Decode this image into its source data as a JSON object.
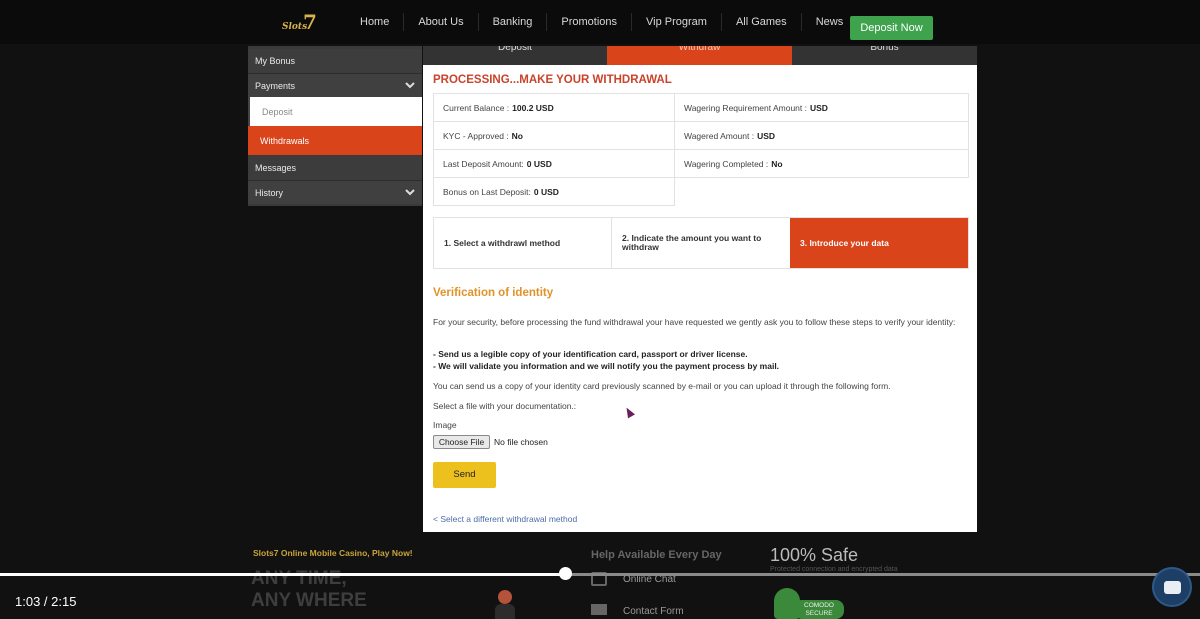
{
  "header": {
    "logo_text": "Slots",
    "logo_seven": "7",
    "nav": [
      "Home",
      "About Us",
      "Banking",
      "Promotions",
      "Vip Program",
      "All Games",
      "News"
    ],
    "deposit_now": "Deposit Now",
    "deposit_now_color": "#3fa34d"
  },
  "sidebar": {
    "items": [
      {
        "label": "My Bonus"
      },
      {
        "label": "Payments",
        "icon": "chevron-down-icon"
      },
      {
        "label": "Deposit"
      },
      {
        "label": "Withdrawals"
      },
      {
        "label": "Messages"
      },
      {
        "label": "History",
        "icon": "chevron-down-icon"
      }
    ],
    "active_color": "#d9441b"
  },
  "tabs": [
    "Deposit",
    "Withdraw",
    "Bonus"
  ],
  "main": {
    "title": "PROCESSING...MAKE YOUR WITHDRAWAL",
    "info": {
      "current_balance_label": "Current Balance :",
      "current_balance_value": "100.2 USD",
      "wagering_req_label": "Wagering Requirement Amount :",
      "wagering_req_value": "USD",
      "kyc_label": "KYC - Approved :",
      "kyc_value": "No",
      "wagered_label": "Wagered Amount :",
      "wagered_value": "USD",
      "last_deposit_label": "Last Deposit Amount:",
      "last_deposit_value": "0 USD",
      "wagering_completed_label": "Wagering Completed :",
      "wagering_completed_value": "No",
      "bonus_last_label": "Bonus on Last Deposit:",
      "bonus_last_value": "0 USD"
    },
    "steps": [
      "1. Select a withdrawl method",
      "2. Indicate the amount you want to withdraw",
      "3. Introduce your data"
    ],
    "verification_title": "Verification of identity",
    "intro": "For your security, before processing the fund withdrawal your have requested we gently ask you to follow these steps to verify your identity:",
    "bullet1": "- Send us a legible copy of your identification card, passport or driver license.",
    "bullet2": "- We will validate you information and we will notify you the payment process by mail.",
    "send_copy": "You can send us a copy of your identity card previously scanned by e-mail or you can upload it through the following form.",
    "select_file": "Select a file with your documentation.:",
    "image_label": "Image",
    "choose_file": "Choose File",
    "no_file": "No file chosen",
    "send": "Send",
    "select_different": "< Select a different withdrawal method"
  },
  "footer": {
    "promo": "Slots7 Online Mobile Casino, Play Now!",
    "anytime_line1": "ANY TIME,",
    "anytime_line2": "ANY WHERE",
    "help_title": "Help Available Every Day",
    "online_chat": "Online Chat",
    "contact_form": "Contact Form",
    "safe_title": "100% Safe",
    "safe_sub": "Protected connection and encrypted data",
    "comodo_line1": "COMODO",
    "comodo_line2": "SECURE"
  },
  "video": {
    "time": "1:03 / 2:15",
    "progress_fraction": 0.4711
  }
}
